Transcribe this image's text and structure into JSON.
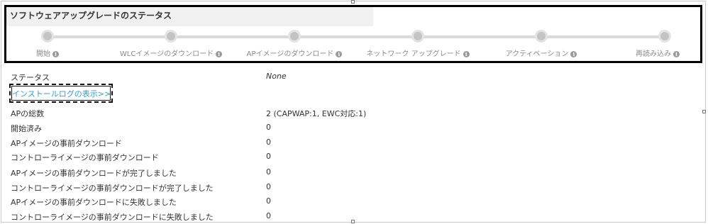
{
  "status_box": {
    "title": "ソフトウェアアップグレードのステータス",
    "steps": [
      {
        "label": "開始"
      },
      {
        "label": "WLCイメージのダウンロード"
      },
      {
        "label": "APイメージのダウンロード"
      },
      {
        "label": "ネットワーク アップグレード"
      },
      {
        "label": "アクティベーション"
      },
      {
        "label": "再読み込み"
      }
    ],
    "info_icon_glyph": "i"
  },
  "status": {
    "label": "ステータス",
    "value": "None"
  },
  "install_log_link": "インストールログの表示>>",
  "rows": [
    {
      "label": "APの総数",
      "value": "2 (CAPWAP:1, EWC対応:1)"
    },
    {
      "label": "開始済み",
      "value": "0"
    },
    {
      "label": "APイメージの事前ダウンロード",
      "value": "0"
    },
    {
      "label": "コントローライメージの事前ダウンロード",
      "value": "0"
    },
    {
      "label": "APイメージの事前ダウンロードが完了しました",
      "value": "0"
    },
    {
      "label": "コントローライメージの事前ダウンロードが完了しました",
      "value": "0"
    },
    {
      "label": "APイメージの事前ダウンロードに失敗しました",
      "value": "0"
    },
    {
      "label": "コントローライメージの事前ダウンロードに失敗しました",
      "value": "0"
    }
  ],
  "colors": {
    "link": "#2f9fd0",
    "step_dot": "#c4c4c4",
    "track": "#dadada",
    "step_label": "#8a8a8a"
  }
}
